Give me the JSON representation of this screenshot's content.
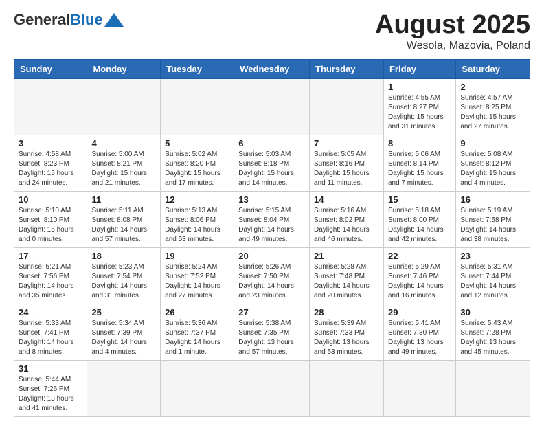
{
  "header": {
    "logo_general": "General",
    "logo_blue": "Blue",
    "title": "August 2025",
    "location": "Wesola, Mazovia, Poland"
  },
  "days_of_week": [
    "Sunday",
    "Monday",
    "Tuesday",
    "Wednesday",
    "Thursday",
    "Friday",
    "Saturday"
  ],
  "weeks": [
    [
      {
        "day": "",
        "info": ""
      },
      {
        "day": "",
        "info": ""
      },
      {
        "day": "",
        "info": ""
      },
      {
        "day": "",
        "info": ""
      },
      {
        "day": "",
        "info": ""
      },
      {
        "day": "1",
        "info": "Sunrise: 4:55 AM\nSunset: 8:27 PM\nDaylight: 15 hours\nand 31 minutes."
      },
      {
        "day": "2",
        "info": "Sunrise: 4:57 AM\nSunset: 8:25 PM\nDaylight: 15 hours\nand 27 minutes."
      }
    ],
    [
      {
        "day": "3",
        "info": "Sunrise: 4:58 AM\nSunset: 8:23 PM\nDaylight: 15 hours\nand 24 minutes."
      },
      {
        "day": "4",
        "info": "Sunrise: 5:00 AM\nSunset: 8:21 PM\nDaylight: 15 hours\nand 21 minutes."
      },
      {
        "day": "5",
        "info": "Sunrise: 5:02 AM\nSunset: 8:20 PM\nDaylight: 15 hours\nand 17 minutes."
      },
      {
        "day": "6",
        "info": "Sunrise: 5:03 AM\nSunset: 8:18 PM\nDaylight: 15 hours\nand 14 minutes."
      },
      {
        "day": "7",
        "info": "Sunrise: 5:05 AM\nSunset: 8:16 PM\nDaylight: 15 hours\nand 11 minutes."
      },
      {
        "day": "8",
        "info": "Sunrise: 5:06 AM\nSunset: 8:14 PM\nDaylight: 15 hours\nand 7 minutes."
      },
      {
        "day": "9",
        "info": "Sunrise: 5:08 AM\nSunset: 8:12 PM\nDaylight: 15 hours\nand 4 minutes."
      }
    ],
    [
      {
        "day": "10",
        "info": "Sunrise: 5:10 AM\nSunset: 8:10 PM\nDaylight: 15 hours\nand 0 minutes."
      },
      {
        "day": "11",
        "info": "Sunrise: 5:11 AM\nSunset: 8:08 PM\nDaylight: 14 hours\nand 57 minutes."
      },
      {
        "day": "12",
        "info": "Sunrise: 5:13 AM\nSunset: 8:06 PM\nDaylight: 14 hours\nand 53 minutes."
      },
      {
        "day": "13",
        "info": "Sunrise: 5:15 AM\nSunset: 8:04 PM\nDaylight: 14 hours\nand 49 minutes."
      },
      {
        "day": "14",
        "info": "Sunrise: 5:16 AM\nSunset: 8:02 PM\nDaylight: 14 hours\nand 46 minutes."
      },
      {
        "day": "15",
        "info": "Sunrise: 5:18 AM\nSunset: 8:00 PM\nDaylight: 14 hours\nand 42 minutes."
      },
      {
        "day": "16",
        "info": "Sunrise: 5:19 AM\nSunset: 7:58 PM\nDaylight: 14 hours\nand 38 minutes."
      }
    ],
    [
      {
        "day": "17",
        "info": "Sunrise: 5:21 AM\nSunset: 7:56 PM\nDaylight: 14 hours\nand 35 minutes."
      },
      {
        "day": "18",
        "info": "Sunrise: 5:23 AM\nSunset: 7:54 PM\nDaylight: 14 hours\nand 31 minutes."
      },
      {
        "day": "19",
        "info": "Sunrise: 5:24 AM\nSunset: 7:52 PM\nDaylight: 14 hours\nand 27 minutes."
      },
      {
        "day": "20",
        "info": "Sunrise: 5:26 AM\nSunset: 7:50 PM\nDaylight: 14 hours\nand 23 minutes."
      },
      {
        "day": "21",
        "info": "Sunrise: 5:28 AM\nSunset: 7:48 PM\nDaylight: 14 hours\nand 20 minutes."
      },
      {
        "day": "22",
        "info": "Sunrise: 5:29 AM\nSunset: 7:46 PM\nDaylight: 14 hours\nand 16 minutes."
      },
      {
        "day": "23",
        "info": "Sunrise: 5:31 AM\nSunset: 7:44 PM\nDaylight: 14 hours\nand 12 minutes."
      }
    ],
    [
      {
        "day": "24",
        "info": "Sunrise: 5:33 AM\nSunset: 7:41 PM\nDaylight: 14 hours\nand 8 minutes."
      },
      {
        "day": "25",
        "info": "Sunrise: 5:34 AM\nSunset: 7:39 PM\nDaylight: 14 hours\nand 4 minutes."
      },
      {
        "day": "26",
        "info": "Sunrise: 5:36 AM\nSunset: 7:37 PM\nDaylight: 14 hours\nand 1 minute."
      },
      {
        "day": "27",
        "info": "Sunrise: 5:38 AM\nSunset: 7:35 PM\nDaylight: 13 hours\nand 57 minutes."
      },
      {
        "day": "28",
        "info": "Sunrise: 5:39 AM\nSunset: 7:33 PM\nDaylight: 13 hours\nand 53 minutes."
      },
      {
        "day": "29",
        "info": "Sunrise: 5:41 AM\nSunset: 7:30 PM\nDaylight: 13 hours\nand 49 minutes."
      },
      {
        "day": "30",
        "info": "Sunrise: 5:43 AM\nSunset: 7:28 PM\nDaylight: 13 hours\nand 45 minutes."
      }
    ],
    [
      {
        "day": "31",
        "info": "Sunrise: 5:44 AM\nSunset: 7:26 PM\nDaylight: 13 hours\nand 41 minutes."
      },
      {
        "day": "",
        "info": ""
      },
      {
        "day": "",
        "info": ""
      },
      {
        "day": "",
        "info": ""
      },
      {
        "day": "",
        "info": ""
      },
      {
        "day": "",
        "info": ""
      },
      {
        "day": "",
        "info": ""
      }
    ]
  ]
}
